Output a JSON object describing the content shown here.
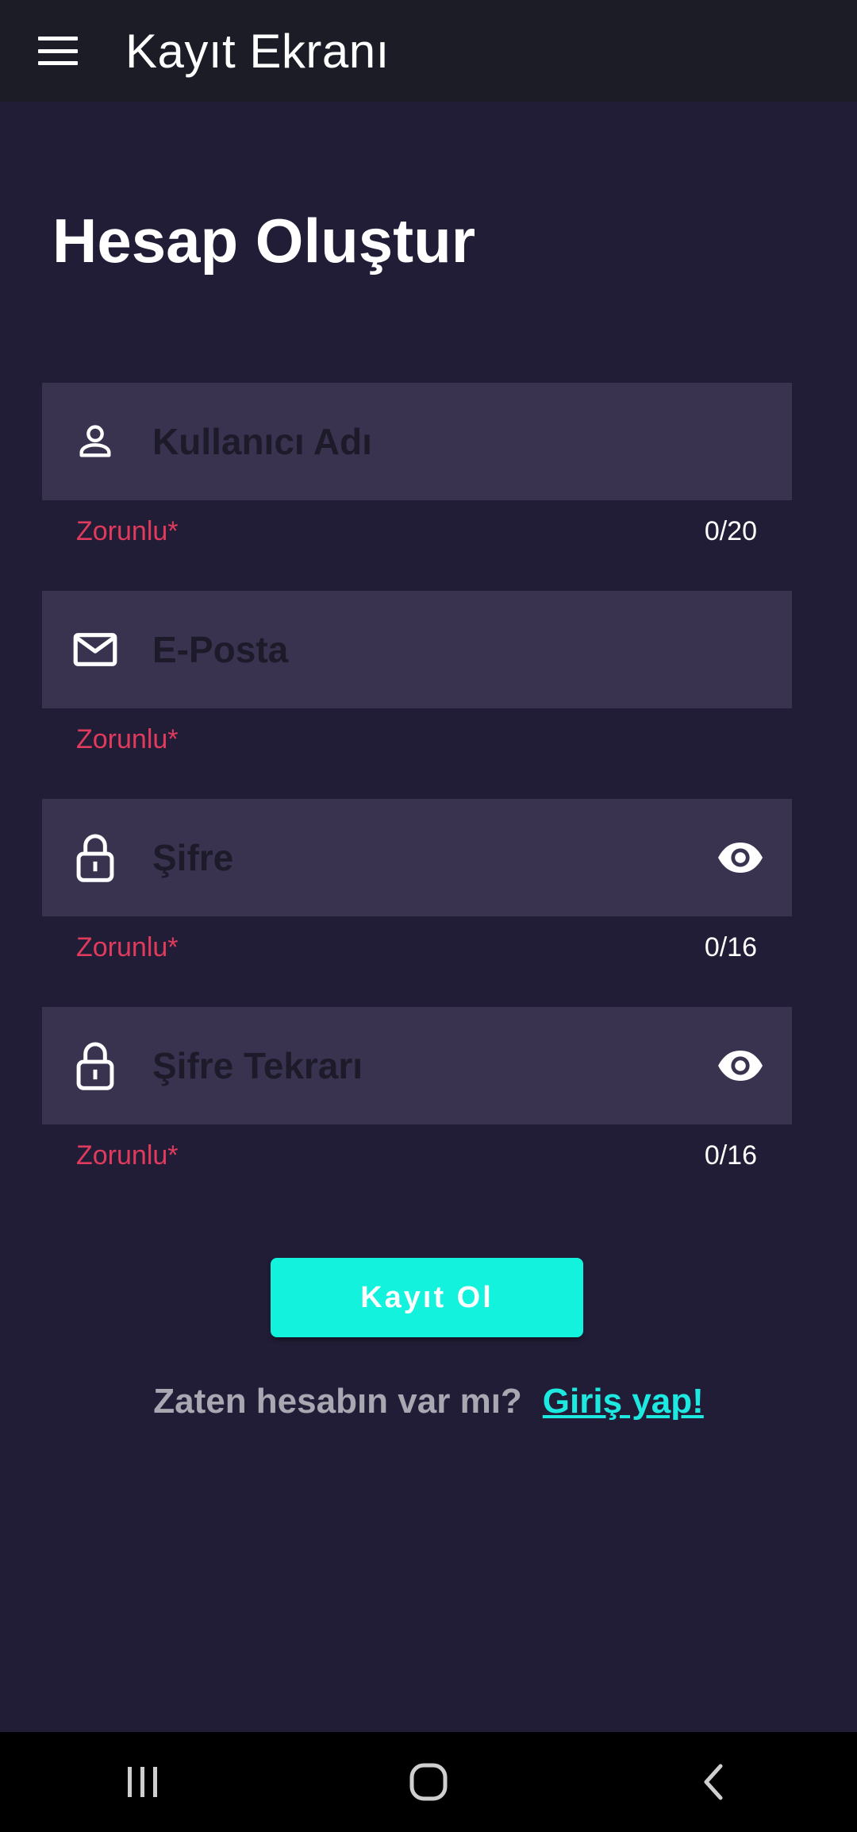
{
  "appbar": {
    "title": "Kayıt Ekranı",
    "menu_icon": "hamburger-menu-icon"
  },
  "page": {
    "heading": "Hesap Oluştur"
  },
  "fields": [
    {
      "placeholder": "Kullanıcı Adı",
      "value": "",
      "icon": "person-icon",
      "helper": "Zorunlu*",
      "counter": "0/20",
      "password": false
    },
    {
      "placeholder": "E-Posta",
      "value": "",
      "icon": "mail-icon",
      "helper": "Zorunlu*",
      "counter": "",
      "password": false
    },
    {
      "placeholder": "Şifre",
      "value": "",
      "icon": "lock-icon",
      "helper": "Zorunlu*",
      "counter": "0/16",
      "password": true,
      "toggle_icon": "eye-icon"
    },
    {
      "placeholder": "Şifre Tekrarı",
      "value": "",
      "icon": "lock-icon",
      "helper": "Zorunlu*",
      "counter": "0/16",
      "password": true,
      "toggle_icon": "eye-icon"
    }
  ],
  "submit": {
    "label": "Kayıt Ol"
  },
  "login": {
    "question": "Zaten hesabın var mı?",
    "link": "Giriş yap!"
  },
  "navbar": {
    "recents_icon": "recent-apps-icon",
    "home_icon": "home-icon",
    "back_icon": "back-icon"
  },
  "colors": {
    "background": "#221d37",
    "appbar": "#1b1c25",
    "field": "#3a3350",
    "accent": "#12f2dd",
    "link": "#1ee9e1",
    "error": "#e03a5c"
  }
}
